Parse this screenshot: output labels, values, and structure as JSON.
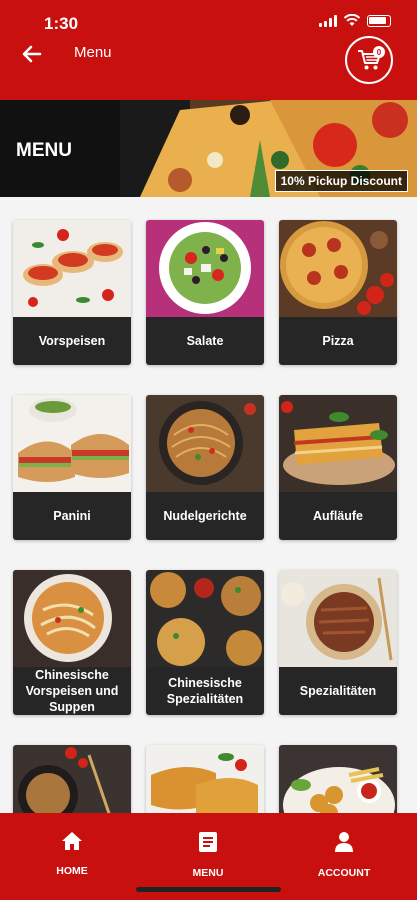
{
  "status": {
    "time": "1:30"
  },
  "header": {
    "title": "Menu",
    "cart_count": "0"
  },
  "banner": {
    "title": "MENU",
    "discount": "10% Pickup Discount"
  },
  "categories": [
    {
      "label": "Vorspeisen"
    },
    {
      "label": "Salate"
    },
    {
      "label": "Pizza"
    },
    {
      "label": "Panini"
    },
    {
      "label": "Nudelgerichte"
    },
    {
      "label": "Aufläufe"
    },
    {
      "label": "Chinesische Vorspeisen und Suppen"
    },
    {
      "label": "Chinesische Spezialitäten"
    },
    {
      "label": "Spezialitäten"
    },
    {
      "label": ""
    },
    {
      "label": ""
    },
    {
      "label": ""
    }
  ],
  "nav": {
    "home": "HOME",
    "menu": "MENU",
    "account": "ACCOUNT"
  },
  "colors": {
    "brand": "#c8100f",
    "card_label_bg": "#262626"
  }
}
